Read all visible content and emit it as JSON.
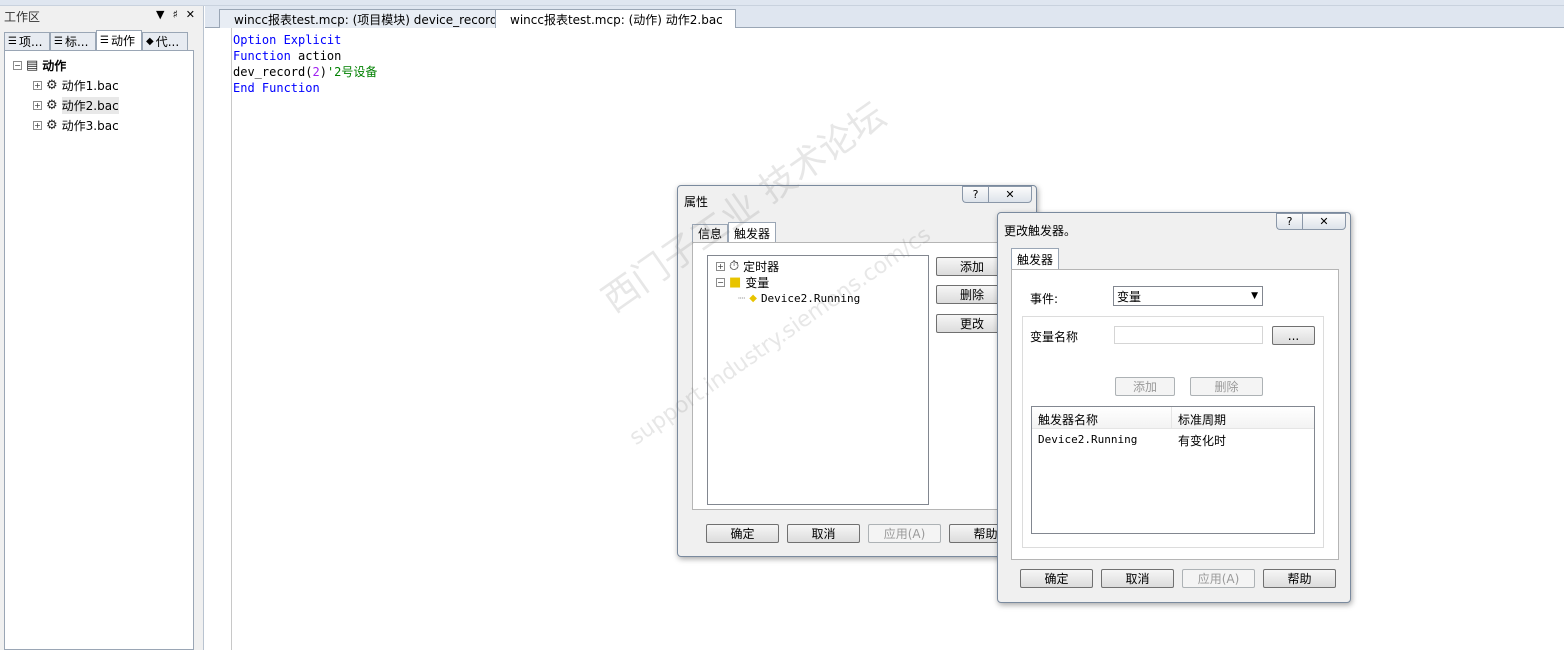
{
  "workspace": {
    "title": "工作区",
    "controls": [
      "▼",
      "♯",
      "✕"
    ],
    "tabs": [
      "项...",
      "标...",
      "动作",
      "代..."
    ],
    "tree": {
      "root": "动作",
      "items": [
        "动作1.bac",
        "动作2.bac",
        "动作3.bac"
      ]
    }
  },
  "doc_tabs": [
    "wincc报表test.mcp: (项目模块) device_record.bmo",
    "wincc报表test.mcp: (动作) 动作2.bac"
  ],
  "code": {
    "line1_kw": "Option Explicit",
    "line2_kw": "Function",
    "line2_rest": " action",
    "line3_a": "dev_record",
    "line3_p1": "(",
    "line3_num": "2",
    "line3_p2": ")",
    "line3_cmt": "'2号设备",
    "line4_kw": "End Function"
  },
  "props_dialog": {
    "title": "属性",
    "help": "?",
    "close": "✕",
    "tabs": [
      "信息",
      "触发器"
    ],
    "tree": {
      "timer": "定时器",
      "tag": "变量",
      "tag_child": "Device2.Running"
    },
    "buttons": {
      "add": "添加",
      "delete": "删除",
      "change": "更改"
    },
    "footer": {
      "ok": "确定",
      "cancel": "取消",
      "apply": "应用(A)",
      "help": "帮助"
    }
  },
  "change_dialog": {
    "title": "更改触发器。",
    "help": "?",
    "close": "✕",
    "tab": "触发器",
    "event_label": "事件:",
    "event_value": "变量",
    "tagname_label": "变量名称",
    "tagname_value": "",
    "browse": "...",
    "add": "添加",
    "delete": "删除",
    "columns": [
      "触发器名称",
      "标准周期"
    ],
    "rows": [
      [
        "Device2.Running",
        "有变化时"
      ]
    ],
    "footer": {
      "ok": "确定",
      "cancel": "取消",
      "apply": "应用(A)",
      "help": "帮助"
    }
  },
  "watermark": {
    "line1": "西门子工业 技术论坛",
    "line2": "support.industry.siemens.com/cs"
  }
}
